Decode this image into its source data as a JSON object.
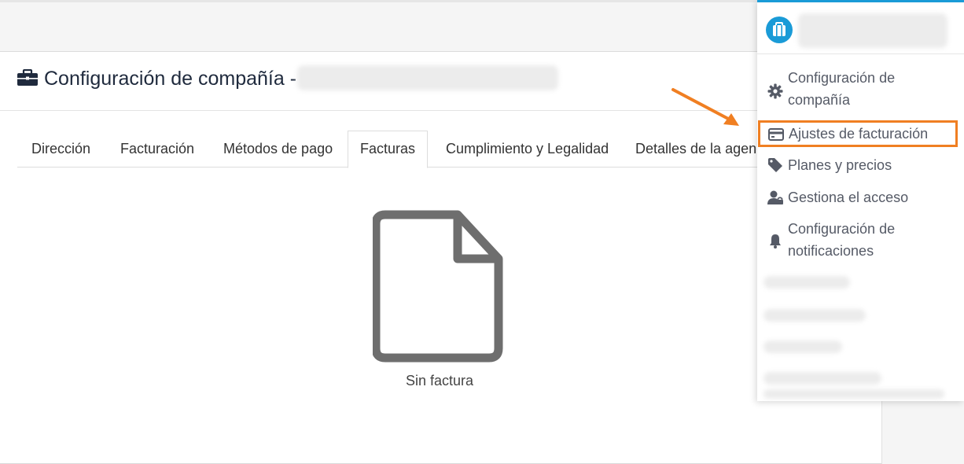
{
  "page": {
    "title": "Configuración de compañía -",
    "title_icon": "briefcase-icon"
  },
  "tabs": [
    {
      "label": "Dirección",
      "active": false
    },
    {
      "label": "Facturación",
      "active": false
    },
    {
      "label": "Métodos de pago",
      "active": false
    },
    {
      "label": "Facturas",
      "active": true
    },
    {
      "label": "Cumplimiento y Legalidad",
      "active": false
    },
    {
      "label": "Detalles de la agencia",
      "active": false
    }
  ],
  "empty_state": {
    "icon": "document-icon",
    "text": "Sin factura"
  },
  "dropdown": {
    "accent_color": "#1a9bd7",
    "highlight_color": "#f07f22",
    "avatar_icon": "briefcase-icon",
    "items": [
      {
        "label": "Configuración de compañía",
        "icon": "gear-icon"
      },
      {
        "label": "Ajustes de facturación",
        "icon": "credit-card-icon",
        "highlighted": true
      },
      {
        "label": "Planes y precios",
        "icon": "tag-icon"
      },
      {
        "label": "Gestiona el acceso",
        "icon": "user-lock-icon"
      },
      {
        "label": "Configuración de notificaciones",
        "icon": "bell-icon"
      }
    ]
  }
}
